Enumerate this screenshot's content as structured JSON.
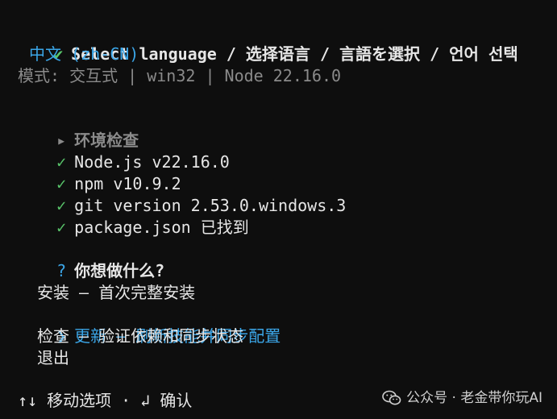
{
  "language_prompt": {
    "check": "✔",
    "question": "Select language / 选择语言 / 言語を選択 / 언어 선택",
    "answer": "中文 (zh-CN)"
  },
  "mode_line": "模式: 交互式 | win32 | Node 22.16.0",
  "env_check": {
    "marker": "▸",
    "title": "环境检查",
    "items": [
      {
        "mark": "✓",
        "text": "Node.js v22.16.0"
      },
      {
        "mark": "✓",
        "text": "npm v10.9.2"
      },
      {
        "mark": "✓",
        "text": "git version 2.53.0.windows.3"
      },
      {
        "mark": "✓",
        "text": "package.json 已找到"
      }
    ]
  },
  "menu": {
    "question_mark": "?",
    "question": "你想做什么?",
    "pointer": "❯",
    "options": [
      {
        "label": "安装 — 首次完整安装",
        "selected": false
      },
      {
        "label": "更新 — 刷新技能并同步配置",
        "selected": true
      },
      {
        "label": "检查 — 验证依赖和同步状态",
        "selected": false
      },
      {
        "label": "退出",
        "selected": false
      }
    ]
  },
  "footer_hint": "↑↓ 移动选项 · ↲ 确认",
  "watermark": {
    "icon": "wechat-icon",
    "text": "公众号 · 老金带你玩AI"
  },
  "colors": {
    "background": "#0e0e0e",
    "green": "#58c46a",
    "cyan": "#3ba6e8",
    "gray": "#8a8a8a",
    "text": "#e6e6e6"
  }
}
